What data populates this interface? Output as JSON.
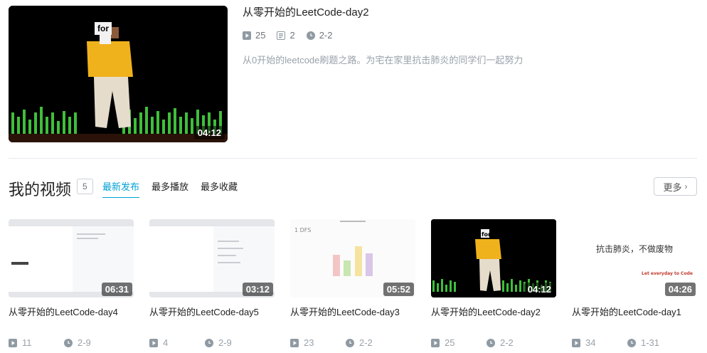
{
  "featured": {
    "title": "从零开始的LeetCode-day2",
    "plays": "25",
    "comments": "2",
    "date": "2-2",
    "description": "从0开始的leetcode刷题之路。为宅在家里抗击肺炎的同学们一起努力",
    "duration": "04:12",
    "thumb_caption": "for"
  },
  "section": {
    "title": "我的视频",
    "count": "5",
    "tabs": [
      "最新发布",
      "最多播放",
      "最多收藏"
    ],
    "more_label": "更多"
  },
  "videos": [
    {
      "title": "从零开始的LeetCode-day4",
      "duration": "06:31",
      "plays": "11",
      "date": "2-9"
    },
    {
      "title": "从零开始的LeetCode-day5",
      "duration": "03:12",
      "plays": "4",
      "date": "2-9"
    },
    {
      "title": "从零开始的LeetCode-day3",
      "duration": "05:52",
      "plays": "23",
      "date": "2-2",
      "thumb_text": "1 DFS"
    },
    {
      "title": "从零开始的LeetCode-day2",
      "duration": "04:12",
      "plays": "25",
      "date": "2-2",
      "thumb_text": "for"
    },
    {
      "title": "从零开始的LeetCode-day1",
      "duration": "04:26",
      "plays": "34",
      "date": "1-31",
      "thumb_text": "抗击肺炎，不做废物",
      "thumb_subtext": "Let everyday to Code"
    }
  ],
  "colors": {
    "accent": "#00a1d6",
    "muted": "#99a2aa"
  }
}
